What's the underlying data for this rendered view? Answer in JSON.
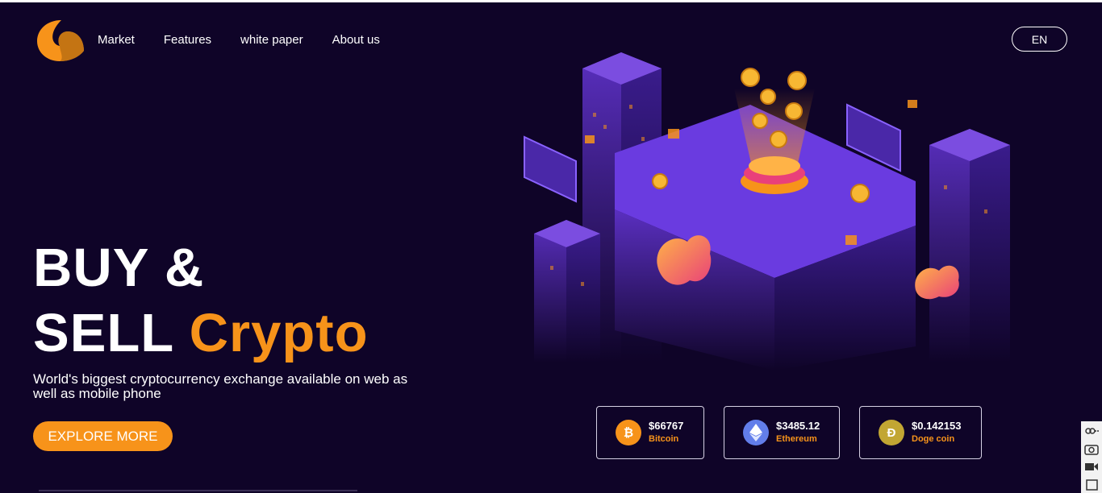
{
  "brand": {
    "logo_icon": "crescent-logo-icon",
    "accent": "#f7931a",
    "background": "#0f0428"
  },
  "nav": {
    "items": [
      {
        "label": "Market"
      },
      {
        "label": "Features"
      },
      {
        "label": "white paper"
      },
      {
        "label": "About us"
      }
    ]
  },
  "language": {
    "label": "EN"
  },
  "hero": {
    "line1": "BUY &",
    "line2_plain": "SELL",
    "line2_accent": "Crypto",
    "subtitle": "World's biggest cryptocurrency exchange available on web as well as mobile phone",
    "cta_label": "EXPLORE MORE"
  },
  "tickers": [
    {
      "price": "$66767",
      "name": "Bitcoin",
      "icon": "bitcoin-icon",
      "color": "#f7931a"
    },
    {
      "price": "$3485.12",
      "name": "Ethereum",
      "icon": "ethereum-icon",
      "color": "#627eea"
    },
    {
      "price": "$0.142153",
      "name": "Doge coin",
      "icon": "dogecoin-icon",
      "color": "#c2a633"
    }
  ],
  "illustration": {
    "name": "isometric-crypto-city-illustration"
  },
  "side_tools": [
    "link-icon",
    "camera-icon",
    "video-icon",
    "window-icon"
  ]
}
